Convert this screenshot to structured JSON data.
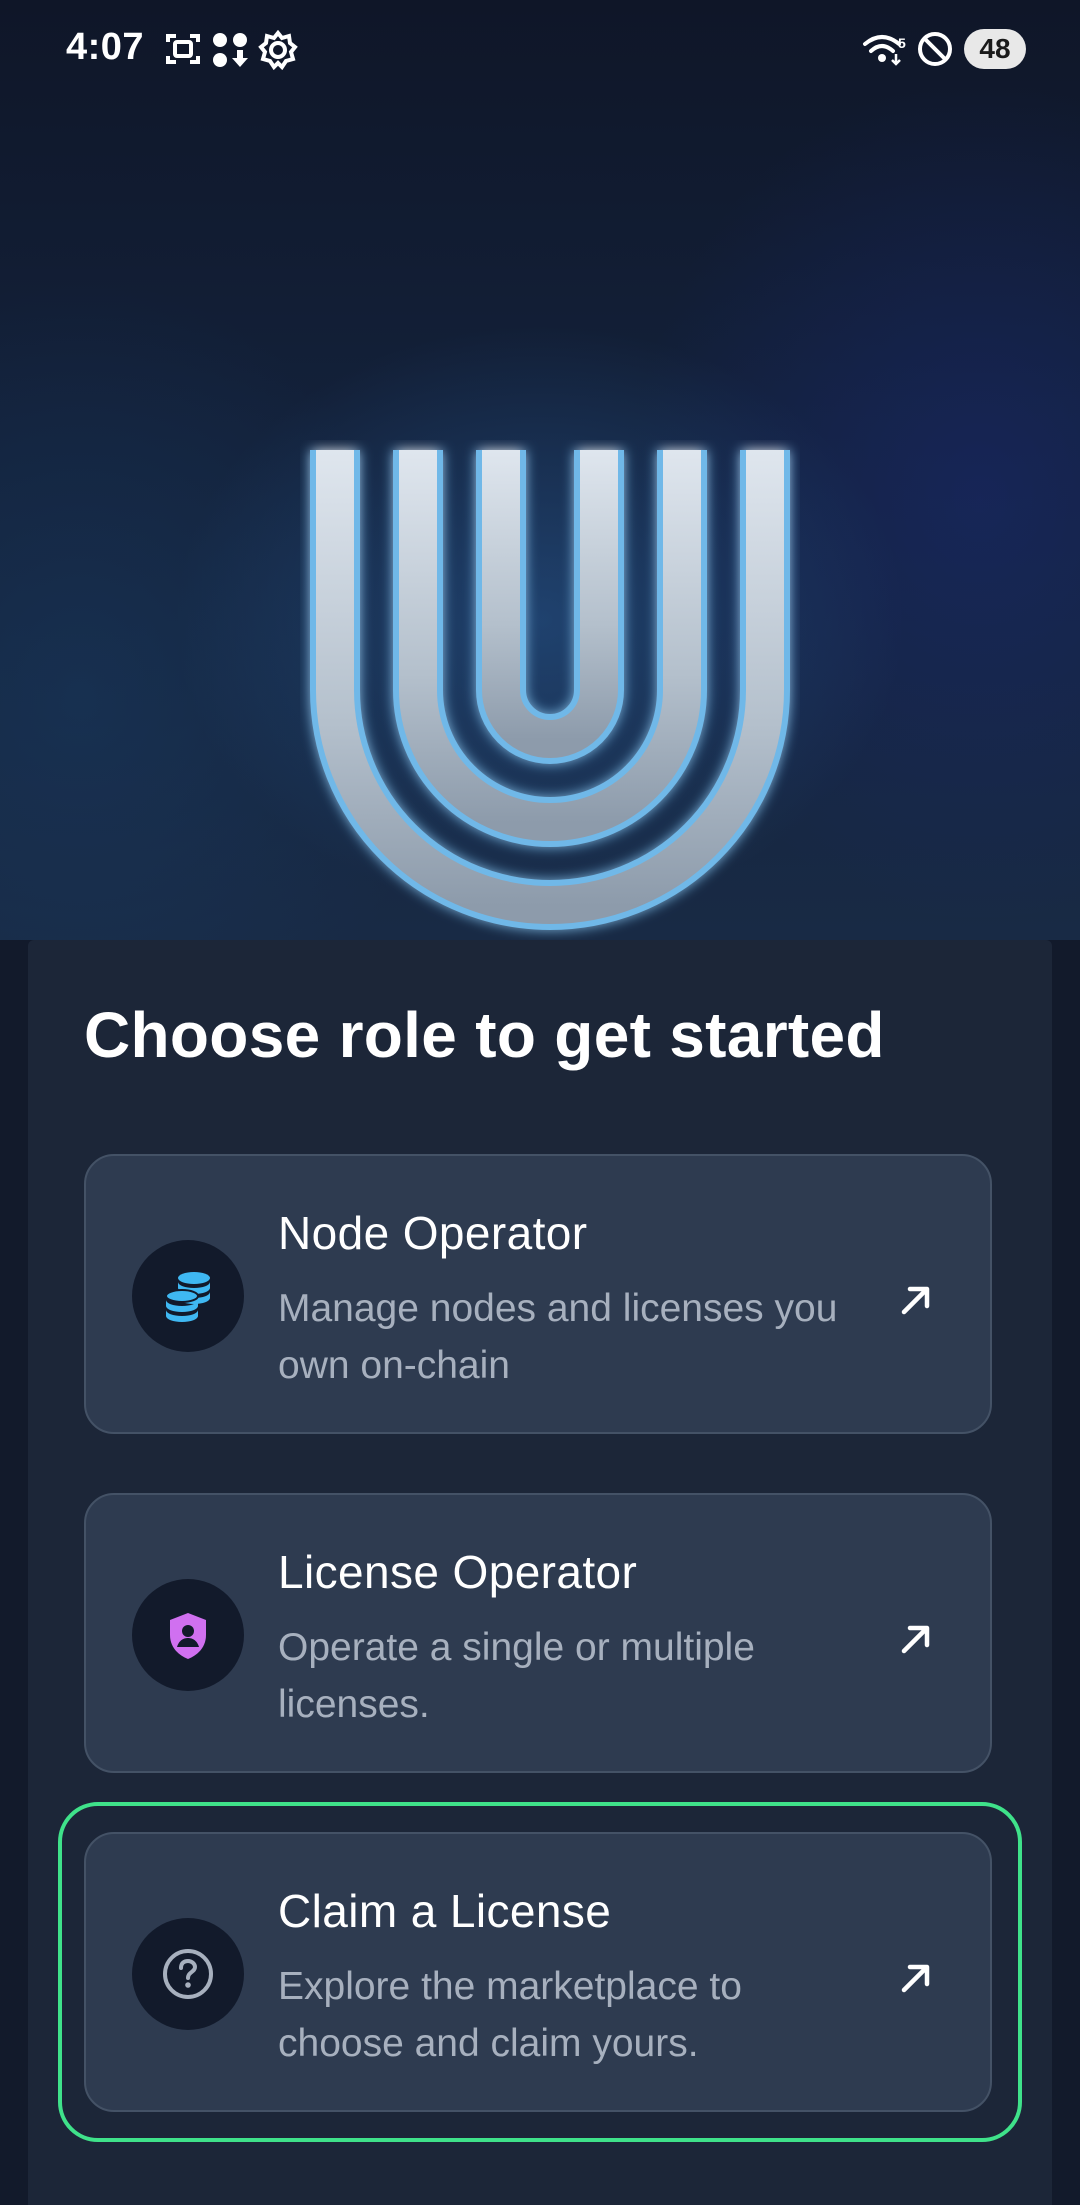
{
  "status_bar": {
    "time": "4:07",
    "wifi_label": "5",
    "battery": "48",
    "icons": [
      "screenshot-icon",
      "apps-download-icon",
      "settings-icon",
      "wifi-icon",
      "do-not-disturb-icon",
      "battery-icon"
    ]
  },
  "hero": {
    "logo": "u-logo"
  },
  "sheet": {
    "title": "Choose role to get started",
    "roles": [
      {
        "title": "Node Operator",
        "description": "Manage nodes and licenses you own on-chain",
        "icon": "coins-stack-icon",
        "icon_color": "#3fb8f2"
      },
      {
        "title": "License Operator",
        "description": "Operate a single or multiple licenses.",
        "icon": "shield-user-icon",
        "icon_color": "#d070f0"
      },
      {
        "title": "Claim a License",
        "description": "Explore the marketplace to choose and claim yours.",
        "icon": "question-circle-icon",
        "icon_color": "#a7b0be",
        "selected": true
      }
    ]
  },
  "colors": {
    "background": "#121a2b",
    "sheet": "#1c2638",
    "card": "#2e3b50",
    "selected_outline": "#3fe28a"
  }
}
